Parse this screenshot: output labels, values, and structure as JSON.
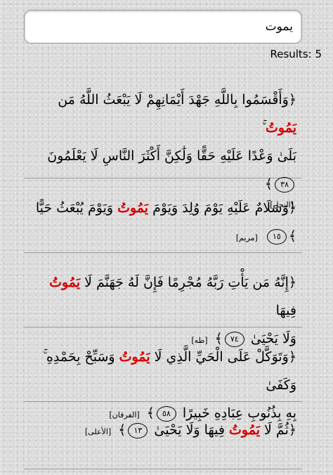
{
  "search": {
    "value": "يموت"
  },
  "results_label": "Results: 5",
  "results": [
    {
      "line1_pre": "﴿وَأَقْسَمُوا بِاللَّهِ جَهْدَ أَيْمَانِهِمْ لَا يَبْعَثُ اللَّهُ مَن ",
      "highlight": "يَمُوتُ",
      "line1_post": " ۚ",
      "line2": "بَلَىٰ وَعْدًا عَلَيْهِ حَقًّا وَلَٰكِنَّ أَكْثَرَ النَّاسِ لَا يَعْلَمُونَ",
      "ayah": "٣٨",
      "surah": "[النحل]"
    },
    {
      "line1_pre": "﴿وَسَلَامٌ عَلَيْهِ يَوْمَ وُلِدَ وَيَوْمَ ",
      "highlight": "يَمُوتُ",
      "line1_post": " وَيَوْمَ يُبْعَثُ حَيًّا",
      "ayah": "١٥",
      "surah": "[مريم]"
    },
    {
      "line1_pre": "﴿إِنَّهُ مَن يَأْتِ رَبَّهُ مُجْرِمًا فَإِنَّ لَهُ جَهَنَّمَ لَا ",
      "highlight": "يَمُوتُ",
      "line1_post": " فِيهَا",
      "line2": "وَلَا يَحْيَىٰ",
      "ayah": "٧٤",
      "surah": "[طه]"
    },
    {
      "line1_pre": "﴿وَتَوَكَّلْ عَلَى الْحَيِّ الَّذِي لَا ",
      "highlight": "يَمُوتُ",
      "line1_post": " وَسَبِّحْ بِحَمْدِهِ ۚ وَكَفَىٰ",
      "line2": "بِهِ بِذُنُوبِ عِبَادِهِ خَبِيرًا",
      "ayah": "٥٨",
      "surah": "[الفرقان]"
    },
    {
      "line1_pre": "﴿ثُمَّ لَا ",
      "highlight": "يَمُوتُ",
      "line1_post": " فِيهَا وَلَا يَحْيَىٰ",
      "ayah": "١٣",
      "surah": "[الأعلى]"
    }
  ]
}
